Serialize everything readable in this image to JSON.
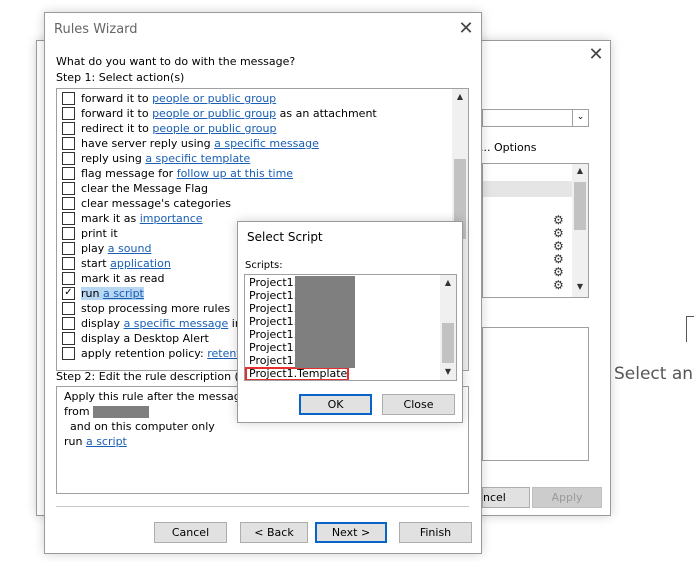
{
  "rules_wizard": {
    "title": "Rules Wizard",
    "question": "What do you want to do with the message?",
    "step1_label": "Step 1: Select action(s)",
    "actions": [
      {
        "pre": "forward it to ",
        "link": "people or public group",
        "post": "",
        "checked": false
      },
      {
        "pre": "forward it to ",
        "link": "people or public group",
        "post": " as an attachment",
        "checked": false
      },
      {
        "pre": "redirect it to ",
        "link": "people or public group",
        "post": "",
        "checked": false
      },
      {
        "pre": "have server reply using ",
        "link": "a specific message",
        "post": "",
        "checked": false
      },
      {
        "pre": "reply using ",
        "link": "a specific template",
        "post": "",
        "checked": false
      },
      {
        "pre": "flag message for ",
        "link": "follow up at this time",
        "post": "",
        "checked": false
      },
      {
        "pre": "clear the Message Flag",
        "link": "",
        "post": "",
        "checked": false
      },
      {
        "pre": "clear message's categories",
        "link": "",
        "post": "",
        "checked": false
      },
      {
        "pre": "mark it as ",
        "link": "importance",
        "post": "",
        "checked": false
      },
      {
        "pre": "print it",
        "link": "",
        "post": "",
        "checked": false
      },
      {
        "pre": "play ",
        "link": "a sound",
        "post": "",
        "checked": false
      },
      {
        "pre": "start ",
        "link": "application",
        "post": "",
        "checked": false
      },
      {
        "pre": "mark it as read",
        "link": "",
        "post": "",
        "checked": false
      },
      {
        "pre": "run ",
        "link": "a script",
        "post": "",
        "checked": true,
        "selected": true
      },
      {
        "pre": "stop processing more rules",
        "link": "",
        "post": "",
        "checked": false
      },
      {
        "pre": "display ",
        "link": "a specific message",
        "post": " in th",
        "checked": false
      },
      {
        "pre": "display a Desktop Alert",
        "link": "",
        "post": "",
        "checked": false
      },
      {
        "pre": "apply retention policy: ",
        "link": "retention",
        "post": "",
        "checked": false
      }
    ],
    "step2_label": "Step 2: Edit the rule description (cli",
    "description": {
      "line1": "Apply this rule after the message a",
      "line2_pre": "from",
      "line3": "and on this computer only",
      "line4_pre": "run ",
      "line4_link": "a script"
    },
    "buttons": {
      "cancel": "Cancel",
      "back": "< Back",
      "next": "Next >",
      "finish": "Finish"
    }
  },
  "background_dialog": {
    "options_label": "... Options",
    "cancel_partial": "ncel",
    "apply": "Apply"
  },
  "background_app": {
    "select_text": "Select an"
  },
  "select_script": {
    "title": "Select Script",
    "scripts_label": "Scripts:",
    "scripts": [
      "Project1.",
      "Project1.",
      "Project1.",
      "Project1.",
      "Project1.",
      "Project1.",
      "Project1.",
      "Project1.Template"
    ],
    "highlighted_index": 7,
    "ok": "OK",
    "close": "Close"
  },
  "colors": {
    "link": "#1a5fb4",
    "selection": "#b7d6f3",
    "highlight_border": "#e03030",
    "default_button_border": "#0a64c8"
  }
}
